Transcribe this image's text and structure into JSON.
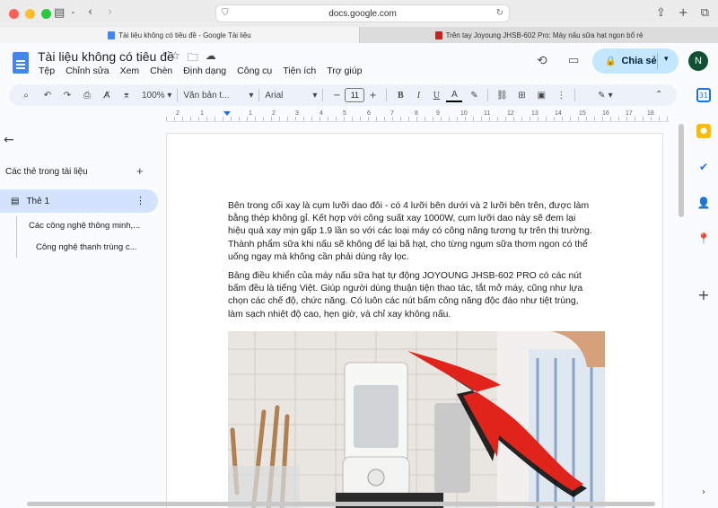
{
  "browser": {
    "url": "docs.google.com",
    "tabs": [
      {
        "title": "Tài liệu không có tiêu đề - Google Tài liệu",
        "active": true,
        "favicon_color": "#4285f4"
      },
      {
        "title": "Trên tay Joyoung JHSB-602 Pro: Máy nấu sữa hạt ngon bổ rẻ",
        "active": false,
        "favicon_color": "#c5221f"
      }
    ]
  },
  "docs": {
    "title": "Tài liệu không có tiêu đề",
    "menu": [
      "Tệp",
      "Chỉnh sửa",
      "Xem",
      "Chèn",
      "Định dạng",
      "Công cụ",
      "Tiện ích",
      "Trợ giúp"
    ],
    "share_label": "Chia sẻ",
    "avatar_letter": "N"
  },
  "toolbar": {
    "zoom": "100%",
    "style": "Văn bản t...",
    "font": "Arial",
    "font_size": "11"
  },
  "ruler": {
    "numbers": [
      "2",
      "1",
      "1",
      "2",
      "3",
      "4",
      "5",
      "6",
      "7",
      "8",
      "9",
      "10",
      "11",
      "12",
      "13",
      "14",
      "15",
      "16",
      "17",
      "18"
    ]
  },
  "sidebar": {
    "section_label": "Các thẻ trong tài liệu",
    "tab_name": "Thẻ 1",
    "headings": [
      "Các công nghệ thông minh,...",
      "Công nghệ thanh trùng c..."
    ]
  },
  "document": {
    "paragraph_1_lines": [
      "Bên trong cối xay là cụm lưỡi dao đôi - có 4 lưỡi bên dưới và 2 lưỡi bên trên, được làm",
      "bằng thép không gỉ. Kết hợp với công suất xay 1000W, cụm lưỡi dao này sẽ đem lại",
      "hiệu quả xay mịn gấp 1.9 lần so với các loại máy có công năng tương tự trên thị trường.",
      "Thành phẩm sữa khi nấu sẽ không để lại bã hạt, cho từng ngụm sữa thơm ngon có thể",
      "uống ngay mà không cần phải dùng rây lọc."
    ],
    "paragraph_2_lines": [
      "Bảng điều khiển của máy nấu sữa hạt tự động JOYOUNG JHSB-602 PRO có các nút",
      "bấm đều là tiếng Việt. Giúp người dùng thuận tiện thao tác, tắt mở máy, cũng như lựa",
      "chọn các chế độ, chức năng. Có luôn các nút bấm công năng độc đáo như tiệt trùng,",
      "làm sạch nhiệt độ cao, hẹn giờ, và chỉ xay không nấu."
    ]
  },
  "colors": {
    "share_bg": "#c2e7ff",
    "active_tab_bg": "#d3e3fd",
    "toolbar_bg": "#edf2fa",
    "arrow_red": "#e0231b"
  },
  "icons": {
    "side_panel": [
      "calendar-icon",
      "keep-icon",
      "tasks-icon",
      "contacts-icon",
      "maps-icon",
      "plus-icon"
    ]
  }
}
